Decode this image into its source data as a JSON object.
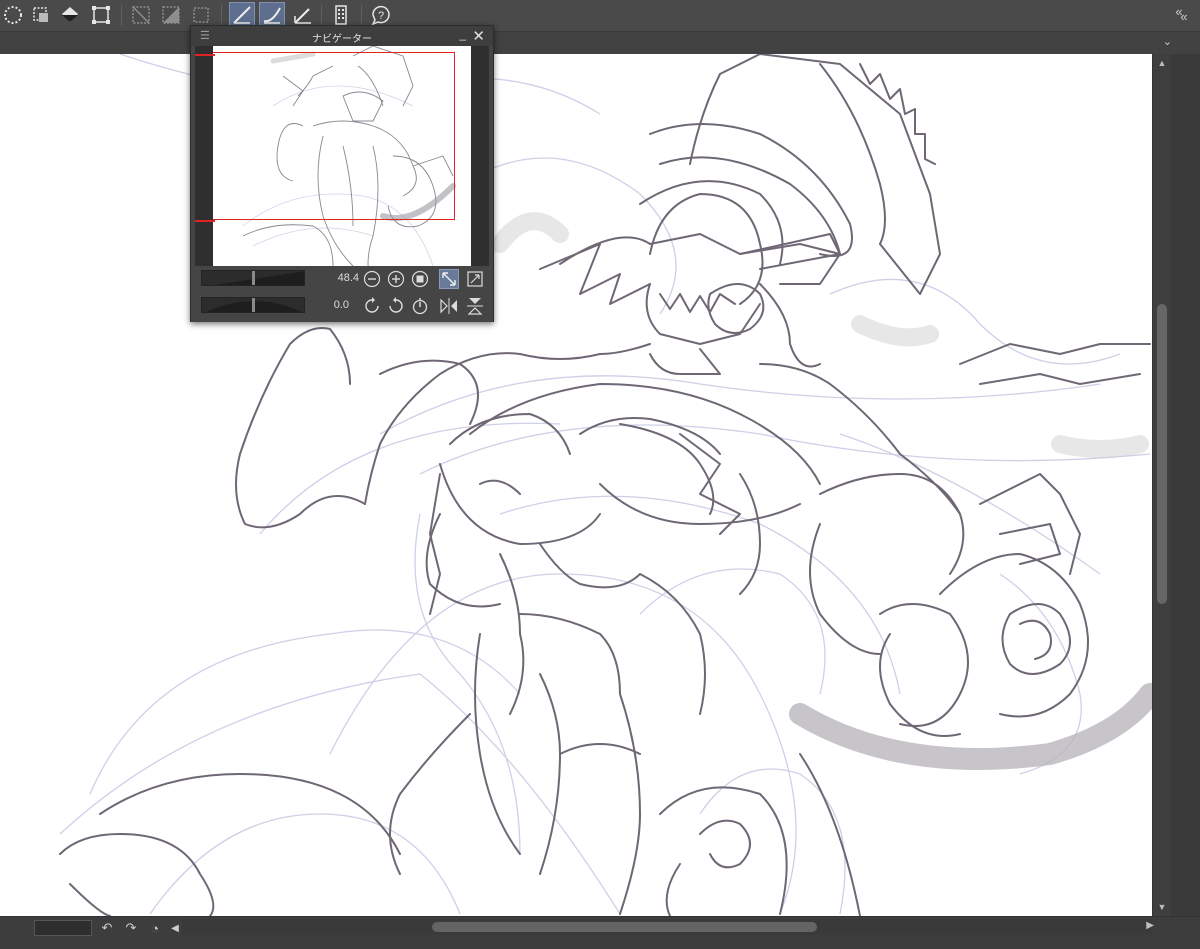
{
  "navigator": {
    "title": "ナビゲーター",
    "zoom_value": "48.4",
    "rotation_value": "0.0"
  },
  "icons": {
    "toolbar": [
      "select-all-icon",
      "select-layer-icon",
      "fill-icon",
      "transform-icon",
      "clear-outside-icon",
      "fill-selection-icon",
      "deselect-icon",
      "pen-pressure-icon",
      "brush-stabilize-icon",
      "vector-icon",
      "pages-icon",
      "help-icon"
    ],
    "navigator": [
      "zoom-out-icon",
      "zoom-in-icon",
      "zoom-reset-icon",
      "fit-to-window-icon",
      "fill-screen-icon",
      "rotate-left-icon",
      "rotate-right-icon",
      "rotate-reset-icon",
      "flip-horizontal-icon",
      "flip-vertical-icon"
    ]
  },
  "colors": {
    "ui_bg": "#4a4a4a",
    "active_button": "#5d6e8e",
    "navigator_frame": "#e02424",
    "sketch_stroke": "#6f6775",
    "sketch_light": "#c9c9e6"
  }
}
